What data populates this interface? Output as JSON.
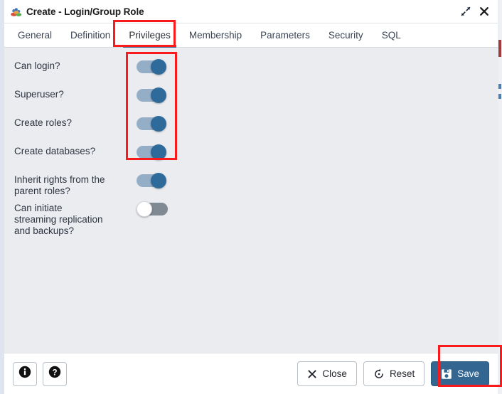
{
  "window": {
    "title": "Create - Login/Group Role",
    "title_icon": "group-role-icon",
    "expand_icon": "expand-icon",
    "close_icon": "close-icon"
  },
  "tabs": [
    {
      "label": "General",
      "active": false
    },
    {
      "label": "Definition",
      "active": false
    },
    {
      "label": "Privileges",
      "active": true
    },
    {
      "label": "Membership",
      "active": false
    },
    {
      "label": "Parameters",
      "active": false
    },
    {
      "label": "Security",
      "active": false
    },
    {
      "label": "SQL",
      "active": false
    }
  ],
  "form": {
    "rows": [
      {
        "label": "Can login?",
        "state": "on"
      },
      {
        "label": "Superuser?",
        "state": "on"
      },
      {
        "label": "Create roles?",
        "state": "on"
      },
      {
        "label": "Create databases?",
        "state": "on"
      },
      {
        "label": "Inherit rights from the\nparent roles?",
        "state": "on"
      },
      {
        "label": "Can initiate\nstreaming replication\nand backups?",
        "state": "off"
      }
    ]
  },
  "footer": {
    "info_icon": "info-icon",
    "help_icon": "help-icon",
    "close": {
      "label": "Close",
      "icon": "x-icon"
    },
    "reset": {
      "label": "Reset",
      "icon": "reset-icon"
    },
    "save": {
      "label": "Save",
      "icon": "save-disk-icon"
    }
  },
  "annotations": {
    "highlight_color": "#f91b1b",
    "targets": [
      "privileges-tab",
      "privilege-toggles-group",
      "save-button"
    ]
  },
  "colors": {
    "accent": "#336791",
    "toggle_on_knob": "#2f6b9a",
    "toggle_on_track": "#93aec6",
    "toggle_off_track": "#808a93",
    "panel_bg": "#eaecf0"
  }
}
